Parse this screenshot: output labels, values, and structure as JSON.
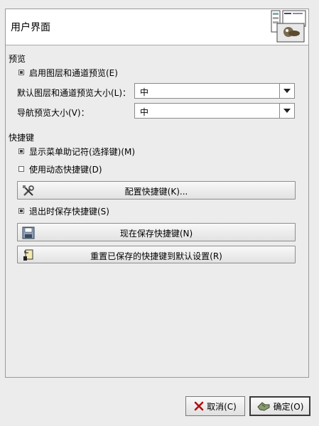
{
  "header": {
    "title": "用户界面"
  },
  "preview": {
    "section_title": "预览",
    "enable_layer_preview": "启用图层和通道预览(E)",
    "enable_layer_preview_checked": true,
    "default_size_label": "默认图层和通道预览大小(L)：",
    "default_size_value": "中",
    "nav_size_label": "导航预览大小(V)：",
    "nav_size_value": "中"
  },
  "shortcuts": {
    "section_title": "快捷键",
    "show_menu_mnemonics": "显示菜单助记符(选择键)(M)",
    "show_menu_mnemonics_checked": true,
    "use_dynamic_shortcuts": "使用动态快捷键(D)",
    "use_dynamic_shortcuts_checked": false,
    "configure_button": "配置快捷键(K)...",
    "save_on_exit": "退出时保存快捷键(S)",
    "save_on_exit_checked": true,
    "save_now_button": "现在保存快捷键(N)",
    "reset_button": "重置已保存的快捷键到默认设置(R)"
  },
  "dialog": {
    "cancel_label": "取消(C)",
    "ok_label": "确定(O)"
  },
  "icons": {
    "header": "preferences-interface-icon",
    "configure": "tools-icon",
    "save": "floppy-disk-icon",
    "reset": "revert-icon",
    "cancel": "close-icon",
    "ok": "ok-hand-icon"
  }
}
